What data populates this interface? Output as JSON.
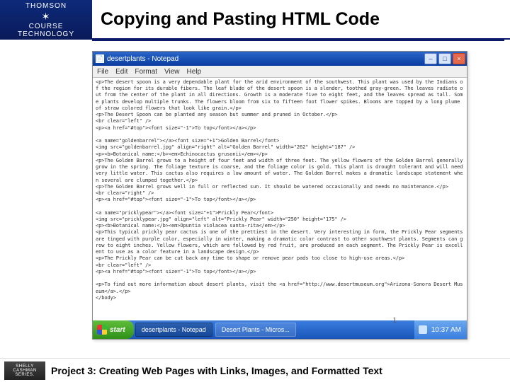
{
  "logo": {
    "top": "THOMSON",
    "bottom": "COURSE TECHNOLOGY"
  },
  "slide_title": "Copying and Pasting HTML Code",
  "notepad": {
    "title": "desertplants - Notepad",
    "menus": [
      "File",
      "Edit",
      "Format",
      "View",
      "Help"
    ],
    "body": "<p>The desert spoon is a very dependable plant for the arid environment of the southwest. This plant was used by the Indians of the region for its durable fibers. The leaf blade of the desert spoon is a slender, toothed gray-green. The leaves radiate out from the center of the plant in all directions. Growth is a moderate five to eight feet, and the leaves spread as tall. Some plants develop multiple trunks. The flowers bloom from six to fifteen foot flower spikes. Blooms are topped by a long plume of straw colored flowers that look like grain.</p>\n<p>The Desert Spoon can be planted any season but summer and pruned in October.</p>\n<br clear=\"left\" />\n<p><a href=\"#top\"><font size=\"-1\">To top</font></a></p>\n\n<a name=\"goldenbarrel\"></a><font size=\"+1\">Golden Barrel</font>\n<img src=\"goldenbarrel.jpg\" align=\"right\" alt=\"Golden Barrel\" width=\"262\" height=\"187\" />\n<p><b>Botanical name:</b><em>Echinocactus grusonii</em></p>\n<p>The Golden Barrel grows to a height of four feet and width of three feet. The yellow flowers of the Golden Barrel generally grow in the spring. The foliage texture is coarse, and the foliage color is gold. This plant is drought tolerant and will need very little water. This cactus also requires a low amount of water. The Golden Barrel makes a dramatic landscape statement when several are clumped together.</p>\n<p>The Golden Barrel grows well in full or reflected sun. It should be watered occasionally and needs no maintenance.</p>\n<br clear=\"right\" />\n<p><a href=\"#top\"><font size=\"-1\">To top</font></a></p>\n\n<a name=\"pricklypear\"></a><font size=\"+1\">Prickly Pear</font>\n<img src=\"pricklypear.jpg\" align=\"left\" alt=\"Prickly Pear\" width=\"250\" height=\"175\" />\n<p><b>Botanical name:</b><em>Opuntia violacea santa-rita</em></p>\n<p>This typical prickly pear cactus is one of the prettiest in the desert. Very interesting in form, the Prickly Pear segments are tinged with purple color, especially in winter, making a dramatic color contrast to other southwest plants. Segments can grow to eight inches. Yellow flowers, which are followed by red fruit, are produced on each segment. The Prickly Pear is excellent to use as a color feature in a landscape design.</p>\n<p>The Prickly Pear can be cut back any time to shape or remove pear pads too close to high-use areas.</p>\n<br clear=\"left\" />\n<p><a href=\"#top\"><font size=\"-1\">To top</font></a></p>\n\n<p>To find out more information about desert plants, visit the <a href=\"http://www.desertmuseum.org\">Arizona-Sonora Desert Museum</a>.</p>\n</body>"
  },
  "taskbar": {
    "start": "start",
    "tasks": [
      "desertplants - Notepad",
      "Desert Plants - Micros..."
    ],
    "clock": "10:37 AM"
  },
  "page_number": "1",
  "footer": {
    "series_top": "SHELLY",
    "series_mid": "CASHMAN",
    "series_bot": "SERIES.",
    "text": "Project 3: Creating Web Pages with Links, Images, and Formatted Text"
  }
}
